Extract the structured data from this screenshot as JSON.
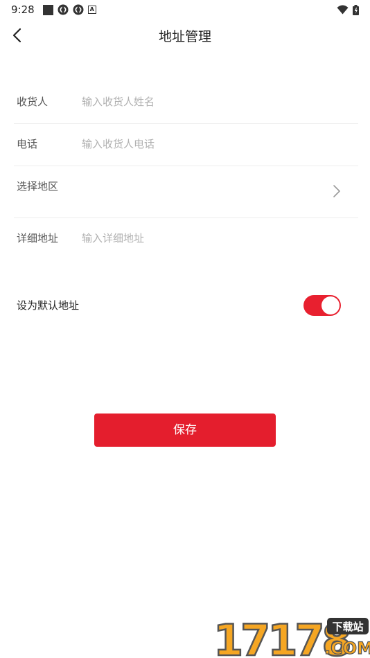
{
  "status_bar": {
    "time": "9:28",
    "icons": [
      "square-notification-icon",
      "ring-notification-icon",
      "ring-notification-icon",
      "a-notification-icon"
    ],
    "right_icons": [
      "wifi-icon",
      "battery-icon"
    ]
  },
  "nav": {
    "title": "地址管理",
    "back_icon": "chevron-left-icon"
  },
  "form": {
    "recipient_label": "收货人",
    "recipient_placeholder": "输入收货人姓名",
    "phone_label": "电话",
    "phone_placeholder": "输入收货人电话",
    "region_label": "选择地区",
    "region_icon": "chevron-right-icon",
    "detail_label": "详细地址",
    "detail_placeholder": "输入详细地址"
  },
  "default_address": {
    "label": "设为默认地址",
    "enabled": true
  },
  "actions": {
    "save_label": "保存"
  },
  "colors": {
    "accent": "#e41e2d",
    "placeholder": "#b0b0b0",
    "divider": "#eeeeee"
  },
  "watermark": {
    "number": "17178",
    "tag": "下载站",
    "suffix": ".COM"
  }
}
